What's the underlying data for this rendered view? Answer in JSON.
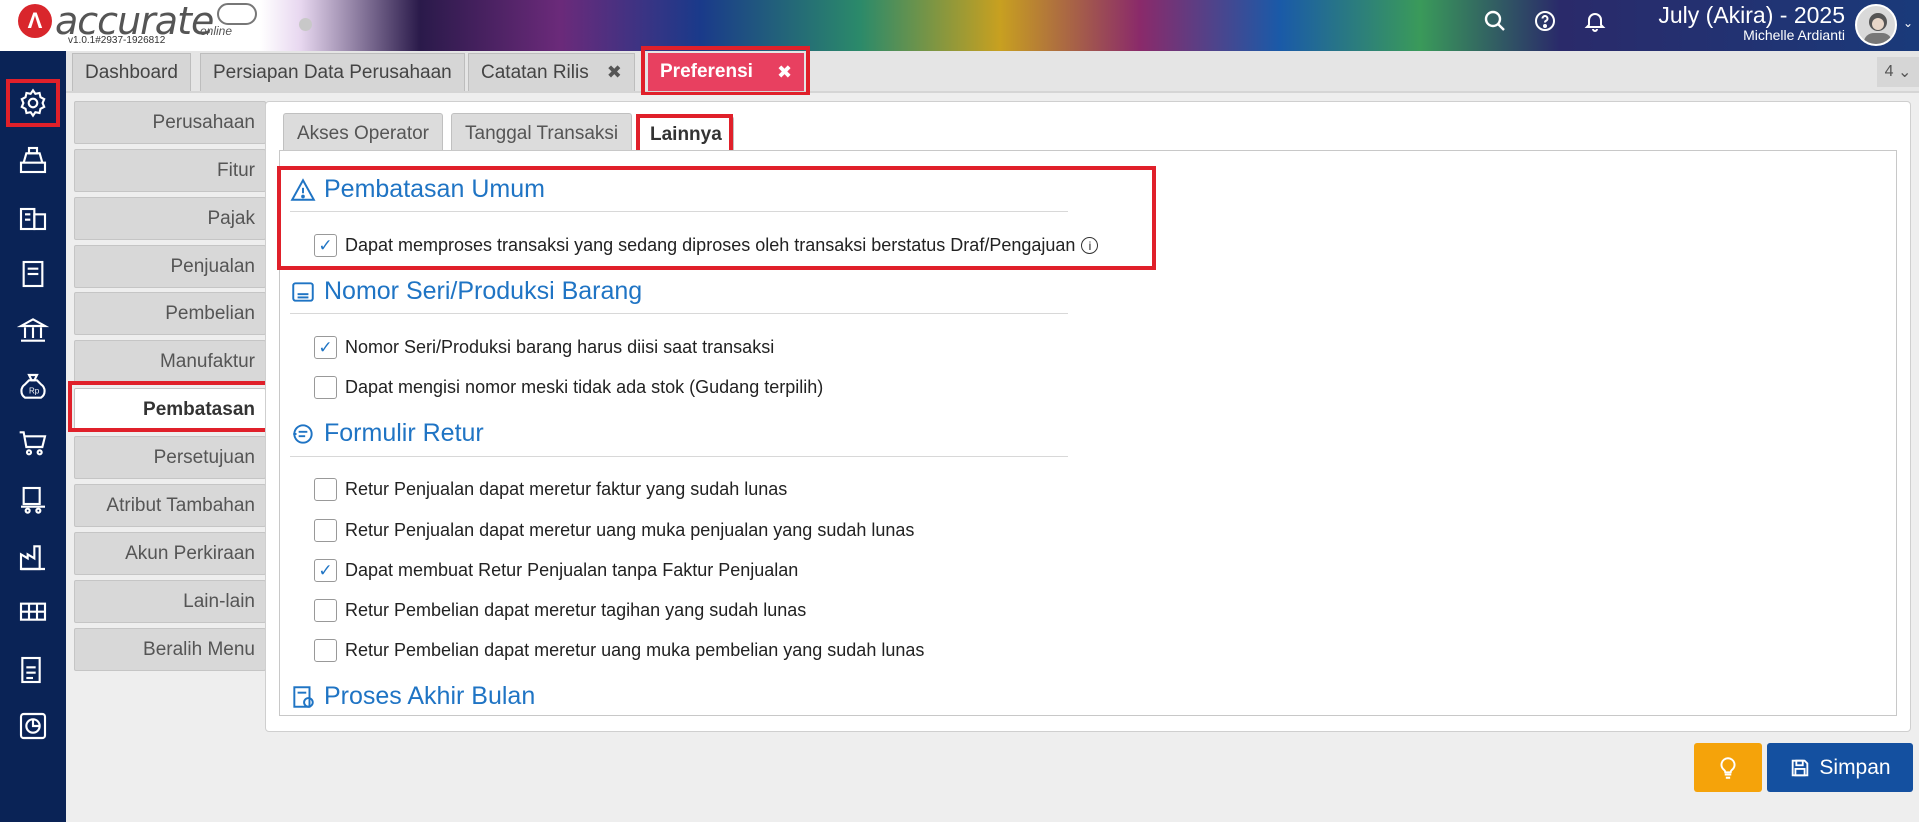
{
  "app": {
    "logo_text": "accurate",
    "logo_sub": "online",
    "version": "v1.0.1#2937-1926812"
  },
  "user": {
    "period": "July (Akira) - 2025",
    "name": "Michelle Ardianti"
  },
  "tabs": [
    {
      "label": "Dashboard"
    },
    {
      "label": "Persiapan Data Perusahaan"
    },
    {
      "label": "Catatan Rilis"
    },
    {
      "label": "Preferensi"
    }
  ],
  "tab_count": "4",
  "side_menu": [
    {
      "label": "Perusahaan"
    },
    {
      "label": "Fitur"
    },
    {
      "label": "Pajak"
    },
    {
      "label": "Penjualan"
    },
    {
      "label": "Pembelian"
    },
    {
      "label": "Manufaktur"
    },
    {
      "label": "Pembatasan"
    },
    {
      "label": "Persetujuan"
    },
    {
      "label": "Atribut Tambahan"
    },
    {
      "label": "Akun Perkiraan"
    },
    {
      "label": "Lain-lain"
    },
    {
      "label": "Beralih Menu"
    }
  ],
  "subtabs": [
    {
      "label": "Akses Operator"
    },
    {
      "label": "Tanggal Transaksi"
    },
    {
      "label": "Lainnya"
    }
  ],
  "sections": {
    "umum": {
      "title": "Pembatasan Umum",
      "opt1": "Dapat memproses transaksi yang sedang diproses oleh transaksi berstatus Draf/Pengajuan"
    },
    "seri": {
      "title": "Nomor Seri/Produksi Barang",
      "opt1": "Nomor Seri/Produksi barang harus diisi saat transaksi",
      "opt2": "Dapat mengisi nomor meski tidak ada stok (Gudang terpilih)"
    },
    "retur": {
      "title": "Formulir Retur",
      "opt1": "Retur Penjualan dapat meretur faktur yang sudah lunas",
      "opt2": "Retur Penjualan dapat meretur uang muka penjualan yang sudah lunas",
      "opt3": "Dapat membuat Retur Penjualan tanpa Faktur Penjualan",
      "opt4": "Retur Pembelian dapat meretur tagihan yang sudah lunas",
      "opt5": "Retur Pembelian dapat meretur uang muka pembelian yang sudah lunas"
    },
    "akhir": {
      "title": "Proses Akhir Bulan"
    }
  },
  "buttons": {
    "save": "Simpan"
  },
  "colors": {
    "accent_blue": "#1f74c4",
    "active_tab": "#e84060",
    "highlight": "#e0202a",
    "nav_bg": "#0a2356",
    "save_bg": "#1450a0",
    "bulb_bg": "#f5a30a"
  }
}
